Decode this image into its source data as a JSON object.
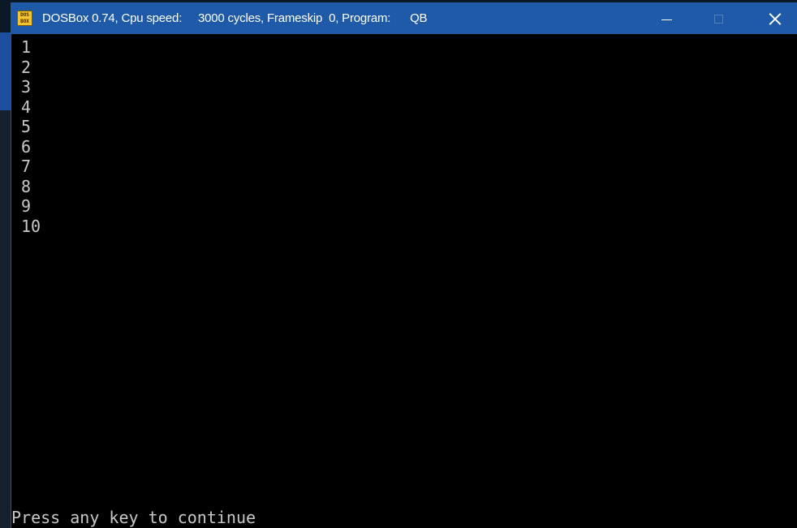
{
  "window": {
    "title": "DOSBox 0.74, Cpu speed:     3000 cycles, Frameskip  0, Program:      QB",
    "icon": "dosbox-icon",
    "icon_text_top": "DOS",
    "icon_text_bottom": "BOX",
    "controls": {
      "minimize": "minimize-icon",
      "maximize": "maximize-icon",
      "close": "close-icon"
    },
    "titlebar_color": "#1e5aa8"
  },
  "console": {
    "lines": [
      "1",
      "2",
      "3",
      "4",
      "5",
      "6",
      "7",
      "8",
      "9",
      "10"
    ],
    "prompt": "Press any key to continue",
    "text_color": "#c8c8c8",
    "background": "#000000"
  }
}
